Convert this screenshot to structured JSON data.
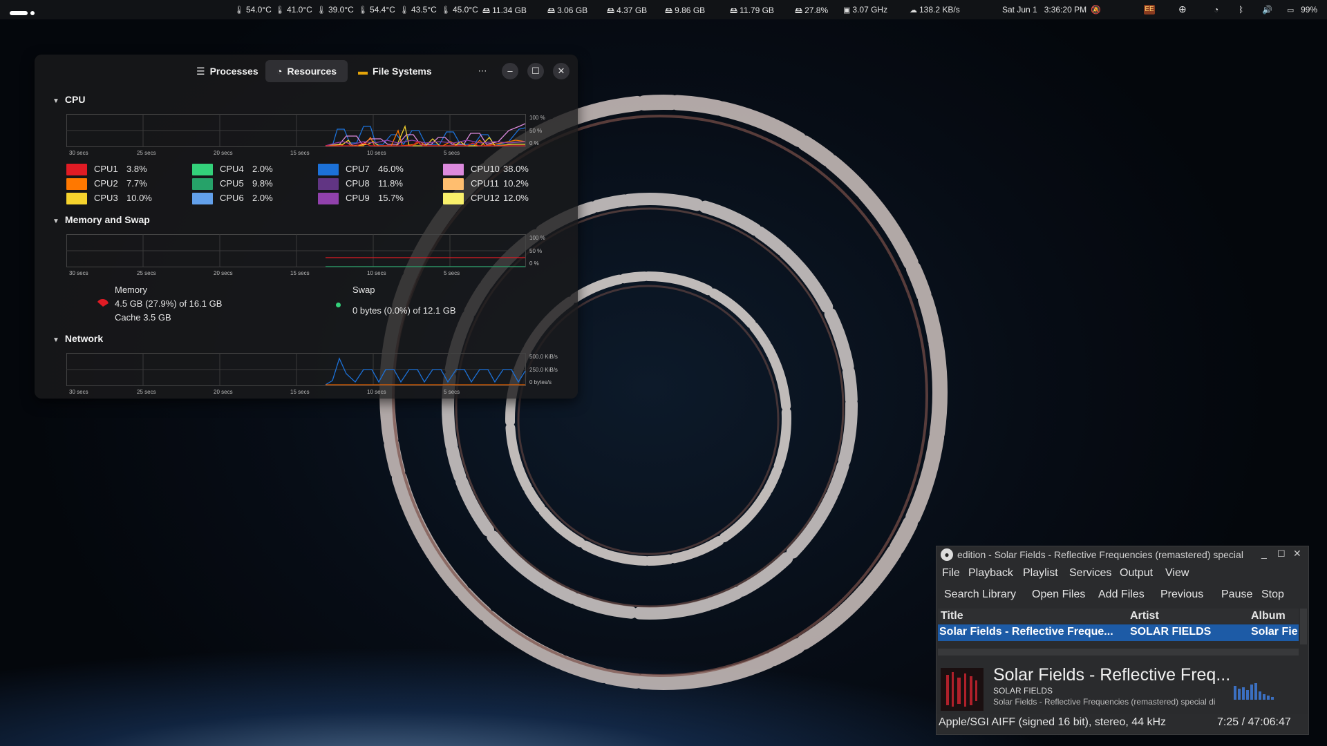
{
  "topbar": {
    "temps": [
      "54.0°C",
      "41.0°C",
      "39.0°C",
      "54.4°C",
      "43.5°C",
      "45.0°C"
    ],
    "disks": [
      "11.34 GB",
      "3.06 GB",
      "4.37 GB",
      "9.86 GB",
      "11.79 GB"
    ],
    "cpu_usage": "27.8%",
    "cpu_freq": "3.07 GHz",
    "net_speed": "138.2 KB/s",
    "date": "Sat Jun 1",
    "time": "3:36:20 PM",
    "battery": "99%",
    "badge": "EE"
  },
  "sysmon": {
    "tabs": [
      "Processes",
      "Resources",
      "File Systems"
    ],
    "more": "⋯",
    "min": "–",
    "max": "☐",
    "close": "✕",
    "cpu": {
      "title": "CPU",
      "time_labels": [
        "30 secs",
        "25 secs",
        "20 secs",
        "15 secs",
        "10 secs",
        "5 secs"
      ],
      "y_labels": [
        "100 %",
        "50 %",
        "0 %"
      ],
      "cores": [
        {
          "name": "CPU1",
          "value": "3.8%",
          "color": "#e01b24"
        },
        {
          "name": "CPU2",
          "value": "7.7%",
          "color": "#ff7800"
        },
        {
          "name": "CPU3",
          "value": "10.0%",
          "color": "#f6d32d"
        },
        {
          "name": "CPU4",
          "value": "2.0%",
          "color": "#33d17a"
        },
        {
          "name": "CPU5",
          "value": "9.8%",
          "color": "#26a269"
        },
        {
          "name": "CPU6",
          "value": "2.0%",
          "color": "#62a0ea"
        },
        {
          "name": "CPU7",
          "value": "46.0%",
          "color": "#1c71d8"
        },
        {
          "name": "CPU8",
          "value": "11.8%",
          "color": "#613583"
        },
        {
          "name": "CPU9",
          "value": "15.7%",
          "color": "#9141ac"
        },
        {
          "name": "CPU10",
          "value": "38.0%",
          "color": "#dc8add"
        },
        {
          "name": "CPU11",
          "value": "10.2%",
          "color": "#ffbe6f"
        },
        {
          "name": "CPU12",
          "value": "12.0%",
          "color": "#f9f06b"
        }
      ]
    },
    "memory": {
      "title": "Memory and Swap",
      "y_labels": [
        "100 %",
        "50 %",
        "0 %"
      ],
      "mem_label": "Memory",
      "mem_value": "4.5 GB (27.9%) of 16.1 GB",
      "cache": "Cache 3.5 GB",
      "swap_label": "Swap",
      "swap_value": "0 bytes (0.0%) of 12.1 GB",
      "mem_color": "#e01b24",
      "swap_color": "#26a269"
    },
    "network": {
      "title": "Network",
      "y_labels": [
        "500.0 KiB/s",
        "250.0 KiB/s",
        "0 bytes/s"
      ]
    }
  },
  "player": {
    "window_title": "edition - Solar Fields - Reflective Frequencies (remastered) special",
    "menu": [
      "File",
      "Playback",
      "Playlist",
      "Services",
      "Output",
      "View"
    ],
    "toolbar": [
      "Search Library",
      "Open Files",
      "Add Files",
      "Previous",
      "Pause",
      "Stop"
    ],
    "columns": [
      "Title",
      "Artist",
      "Album"
    ],
    "row": {
      "title": "Solar Fields - Reflective Freque...",
      "artist": "SOLAR FIELDS",
      "album": "Solar Fie"
    },
    "now_title": "Solar Fields - Reflective Freq...",
    "now_artist": "SOLAR FIELDS",
    "now_album": "Solar Fields - Reflective Frequencies (remastered) special di",
    "format": "Apple/SGI AIFF (signed 16 bit), stereo, 44 kHz",
    "position": "7:25 / 47:06:47"
  }
}
